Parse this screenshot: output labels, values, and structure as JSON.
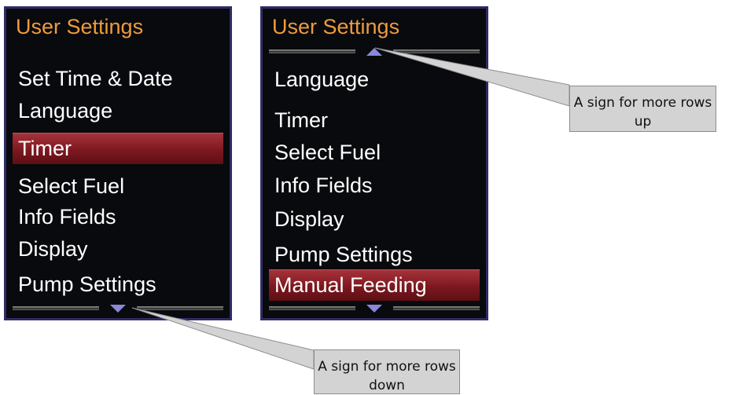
{
  "screens": [
    {
      "title": "User Settings",
      "items": [
        "Set Time & Date",
        "Language",
        "Timer",
        "Select Fuel",
        "Info Fields",
        "Display",
        "Pump Settings"
      ],
      "selected_index": 2,
      "more_rows_up": false,
      "more_rows_down": true
    },
    {
      "title": "User Settings",
      "items": [
        "Language",
        "Timer",
        "Select Fuel",
        "Info Fields",
        "Display",
        "Pump Settings",
        "Manual Feeding"
      ],
      "selected_index": 6,
      "more_rows_up": true,
      "more_rows_down": true
    }
  ],
  "callouts": {
    "up": "A sign for more rows up",
    "down": "A sign for more rows down"
  },
  "colors": {
    "title_text": "#f09a3e",
    "screen_background": "#080a0d",
    "screen_border": "#2e2c64",
    "selection_highlight": "#7d1820",
    "scroll_arrow": "#8a88d8",
    "callout_fill": "#d3d3d3"
  },
  "icons": {
    "scroll_up": "triangle-up-icon",
    "scroll_down": "triangle-down-icon"
  }
}
